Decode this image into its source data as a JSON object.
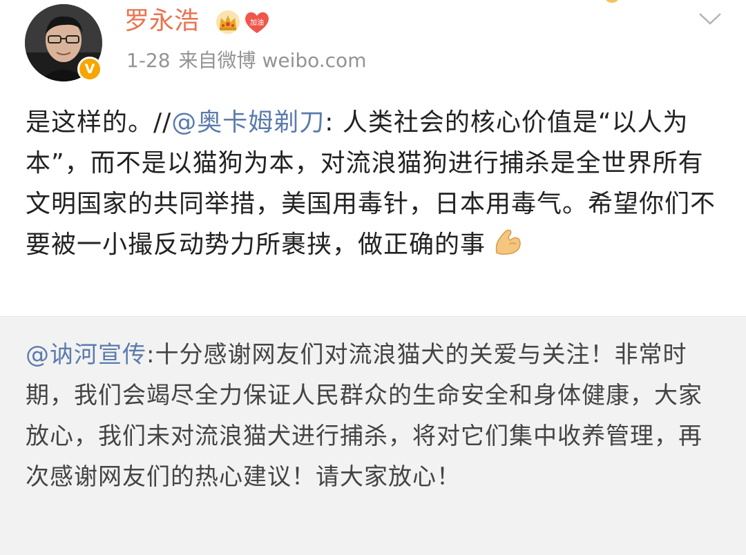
{
  "post": {
    "author": {
      "name": "罗永浩",
      "badge_text": "加油",
      "verified_mark": "V",
      "avatar_icon": "user-avatar",
      "crown_icon": "crown-icon"
    },
    "date": "1-28",
    "source": "来自微博 weibo.com",
    "body": {
      "own_text": "是这样的。//",
      "mention": "@奥卡姆剃刀",
      "quoted_text": ": 人类社会的核心价值是“以人为本”，而不是以猫狗为本，对流浪猫狗进行捕杀是全世界所有文明国家的共同举措，美国用毒针，日本用毒气。希望你们不要被一小撮反动势力所裹挟，做正确的事",
      "emoji": "flexed-biceps-icon"
    }
  },
  "repost": {
    "mention": "@讷河宣传",
    "text": ":十分感谢网友们对流浪猫犬的关爱与关注！非常时期，我们会竭尽全力保证人民群众的生命安全和身体健康，大家放心，我们未对流浪猫犬进行捕杀，将对它们集中收养管理，再次感谢网友们的热心建议！请大家放心！"
  },
  "colors": {
    "username": "#eb7350",
    "mention": "#5b7bac",
    "meta": "#939393",
    "text": "#222222",
    "repost_bg": "#f2f2f2",
    "verified": "#f7a600"
  }
}
